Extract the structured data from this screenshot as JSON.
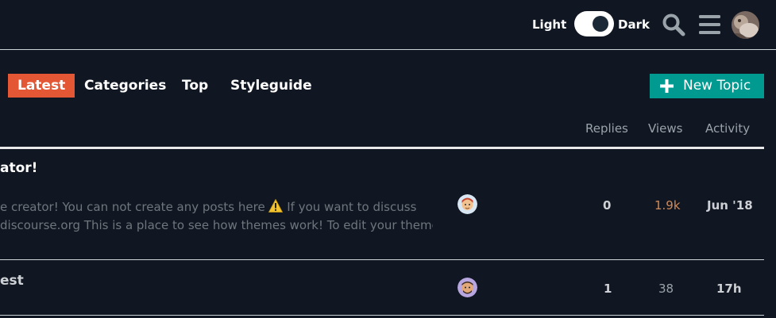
{
  "header": {
    "theme_light_label": "Light",
    "theme_dark_label": "Dark",
    "theme_mode": "dark",
    "icons": [
      "search-icon",
      "hamburger-menu-icon",
      "user-avatar"
    ]
  },
  "nav": {
    "items": [
      {
        "label": "Latest",
        "active": true
      },
      {
        "label": "Categories",
        "active": false
      },
      {
        "label": "Top",
        "active": false
      },
      {
        "label": "Styleguide",
        "active": false
      }
    ],
    "new_topic_label": "New Topic"
  },
  "columns": {
    "replies": "Replies",
    "views": "Views",
    "activity": "Activity"
  },
  "topics": [
    {
      "title": "ator!",
      "excerpt_line1_a": "e creator! You can not create any posts here",
      "excerpt_line1_b": " If you want to discuss",
      "excerpt_line2": "discourse.org This is a place to see how themes work! To edit your themes,",
      "replies": "0",
      "views": "1.9k",
      "activity": "Jun '18"
    },
    {
      "title": "est",
      "replies": "1",
      "views": "38",
      "activity": "17h"
    }
  ],
  "colors": {
    "background": "#111722",
    "accent_latest": "#e45735",
    "new_topic_button": "#009a90",
    "hot_views": "#cf8a5a"
  }
}
